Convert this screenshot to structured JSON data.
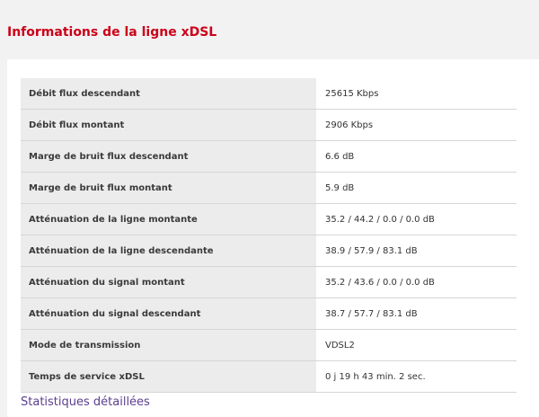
{
  "page_title": "Informations de la ligne xDSL",
  "rows": [
    {
      "label": "Débit flux descendant",
      "value": "25615 Kbps"
    },
    {
      "label": "Débit flux montant",
      "value": "2906 Kbps"
    },
    {
      "label": "Marge de bruit flux descendant",
      "value": "6.6 dB"
    },
    {
      "label": "Marge de bruit flux montant",
      "value": "5.9 dB"
    },
    {
      "label": "Atténuation de la ligne montante",
      "value": "35.2 / 44.2 / 0.0 / 0.0 dB"
    },
    {
      "label": "Atténuation de la ligne descendante",
      "value": "38.9 / 57.9 / 83.1 dB"
    },
    {
      "label": "Atténuation du signal montant",
      "value": "35.2 / 43.6 / 0.0 / 0.0 dB"
    },
    {
      "label": "Atténuation du signal descendant",
      "value": "38.7 / 57.7 / 83.1 dB"
    },
    {
      "label": "Mode de transmission",
      "value": "VDSL2"
    },
    {
      "label": "Temps de service xDSL",
      "value": "0 j 19 h 43 min. 2 sec."
    }
  ],
  "detail_link": "Statistiques détaillées",
  "colors": {
    "title": "#cc0018",
    "link": "#5b3e8f",
    "label_bg": "#ececec"
  }
}
